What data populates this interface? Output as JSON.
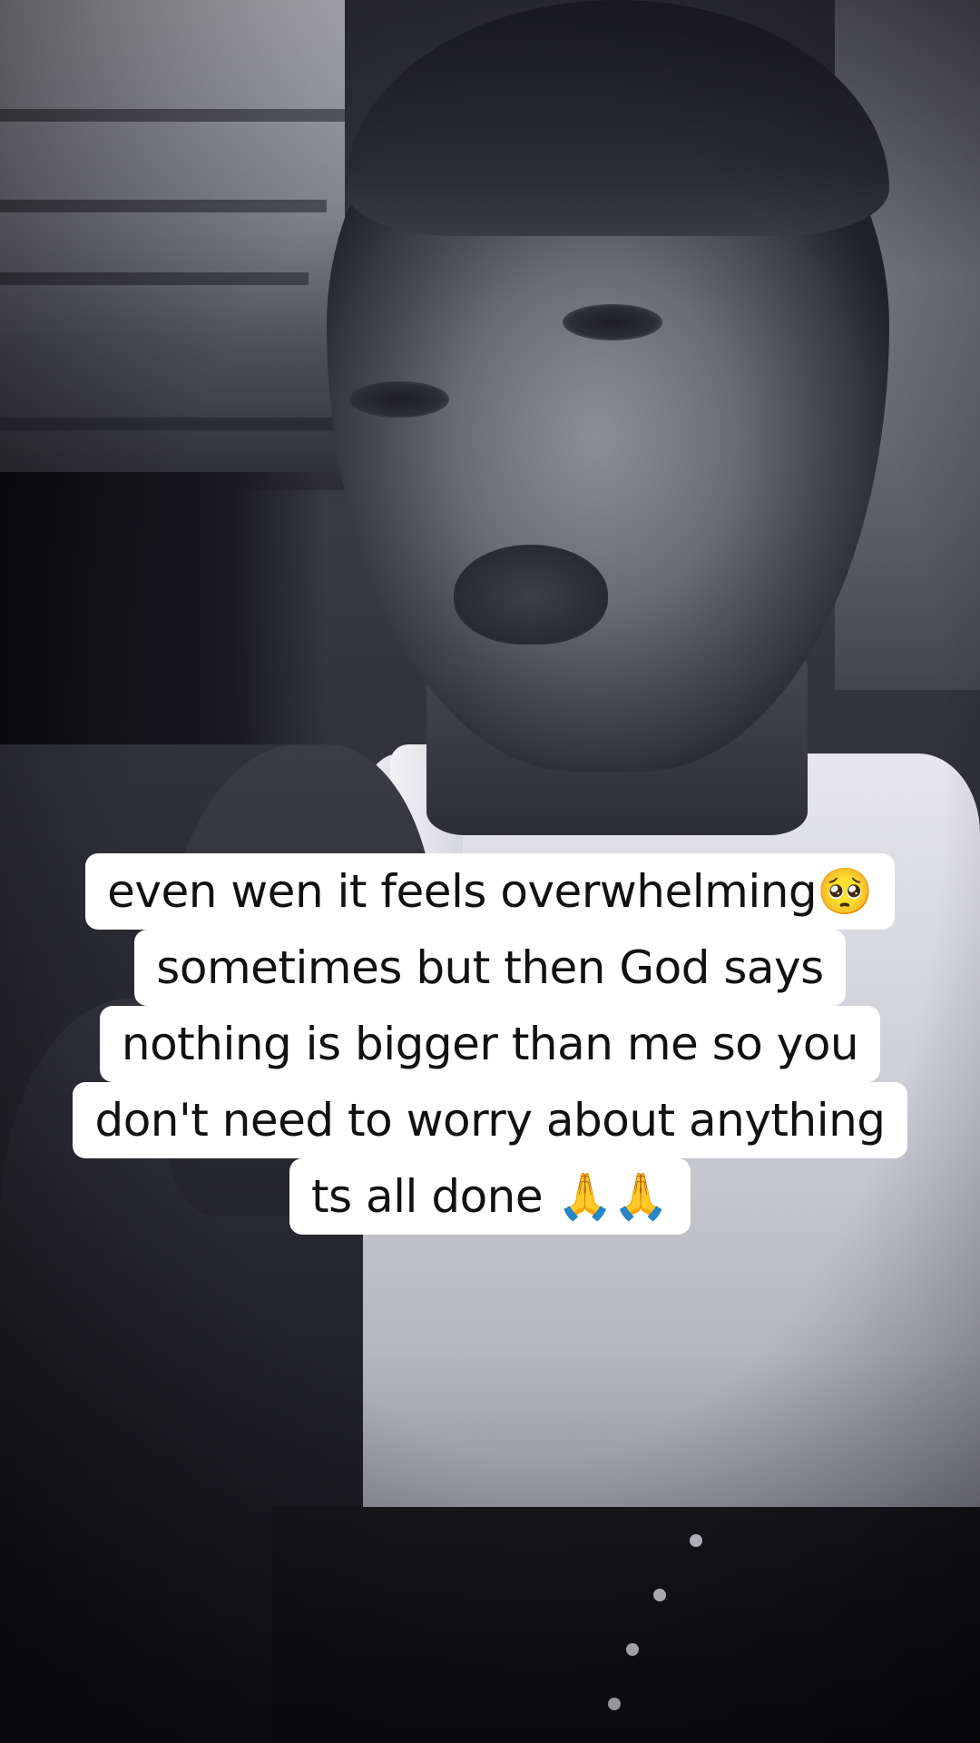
{
  "caption": {
    "lines": [
      "even wen it feels overwhelming🥺",
      "sometimes but then God says",
      "nothing is bigger than me so you",
      "don't need to worry about anything",
      "ts all done 🙏🙏"
    ]
  },
  "colors": {
    "caption_background": "#ffffff",
    "caption_text": "#111111",
    "photo_tone": "monochrome-blue-gray"
  }
}
